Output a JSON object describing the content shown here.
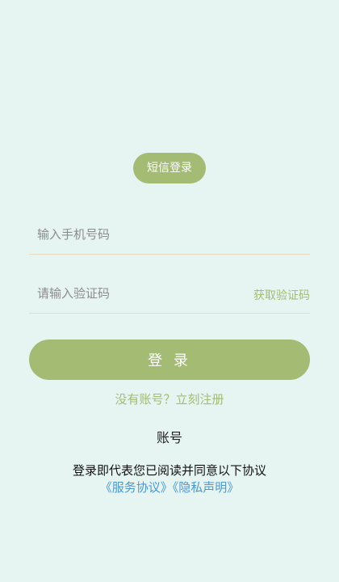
{
  "login_mode": {
    "label": "短信登录"
  },
  "phone_field": {
    "value": "",
    "placeholder": "输入手机号码"
  },
  "code_field": {
    "value": "",
    "placeholder": "请输入验证码",
    "get_code_label": "获取验证码"
  },
  "login_button": {
    "label": "登 录"
  },
  "register_link": {
    "label": "没有账号？立刻注册"
  },
  "account_link": {
    "label": "账号"
  },
  "agreement": {
    "text": "登录即代表您已阅读并同意以下协议",
    "service_label": "《服务协议》",
    "privacy_label": "《隐私声明》"
  },
  "colors": {
    "background": "#e6f5f2",
    "accent": "#a3bb73",
    "link": "#4a98d6",
    "divider": "#e9dcc0"
  }
}
